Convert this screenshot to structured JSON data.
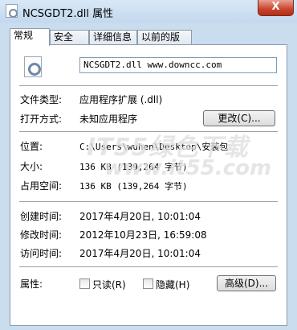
{
  "window": {
    "title": "NCSGDT2.dll 属性",
    "close_label": "X"
  },
  "tabs": [
    {
      "label": "常规",
      "active": true
    },
    {
      "label": "安全",
      "active": false
    },
    {
      "label": "详细信息",
      "active": false
    },
    {
      "label": "以前的版本",
      "active": false
    }
  ],
  "general": {
    "file_name": "NCSGDT2.dll www.downcc.com",
    "type_label": "文件类型:",
    "type_value": "应用程序扩展 (.dll)",
    "opens_label": "打开方式:",
    "opens_value": "未知应用程序",
    "change_button": "更改(C)...",
    "location_label": "位置:",
    "location_value": "C:\\Users\\wuhen\\Desktop\\安装包",
    "size_label": "大小:",
    "size_value": "136 KB (139,264 字节)",
    "size_on_disk_label": "占用空间:",
    "size_on_disk_value": "136 KB (139,264 字节)",
    "created_label": "创建时间:",
    "created_value": "2017年4月20日, 10:01:04",
    "modified_label": "修改时间:",
    "modified_value": "2012年10月23日, 16:59:08",
    "accessed_label": "访问时间:",
    "accessed_value": "2017年4月20日, 10:01:04",
    "attributes_label": "属性:",
    "readonly_label": "只读(R)",
    "hidden_label": "隐藏(H)",
    "advanced_button": "高级(D)..."
  },
  "watermark": {
    "line1": "IT55绿色下载",
    "line2": "www.it55.com"
  }
}
